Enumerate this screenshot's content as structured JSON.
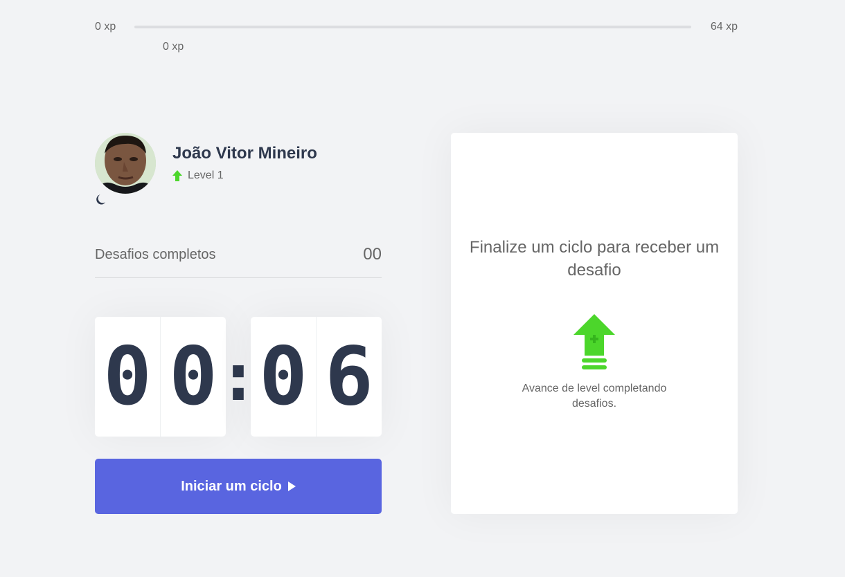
{
  "xp_bar": {
    "min_label": "0 xp",
    "max_label": "64 xp",
    "current_label": "0 xp",
    "progress": 0
  },
  "profile": {
    "name": "João Vitor Mineiro",
    "level_label": "Level 1",
    "level_icon": "level-up-arrow-icon",
    "theme_icon": "moon-icon"
  },
  "completed_challenges": {
    "label": "Desafios completos",
    "value": "00"
  },
  "countdown": {
    "minute_left": "0",
    "minute_right": "0",
    "separator": ":",
    "second_left": "0",
    "second_right": "6"
  },
  "start_button": {
    "label": "Iniciar um ciclo",
    "icon": "play-icon"
  },
  "challenge_box": {
    "title": "Finalize um ciclo para receber um desafio",
    "icon": "level-up-icon",
    "hint": "Avance de level completando desafios."
  },
  "colors": {
    "background": "#f2f3f5",
    "accent": "#5965e0",
    "green": "#4cd62b",
    "title": "#2e384d",
    "text": "#666666"
  }
}
